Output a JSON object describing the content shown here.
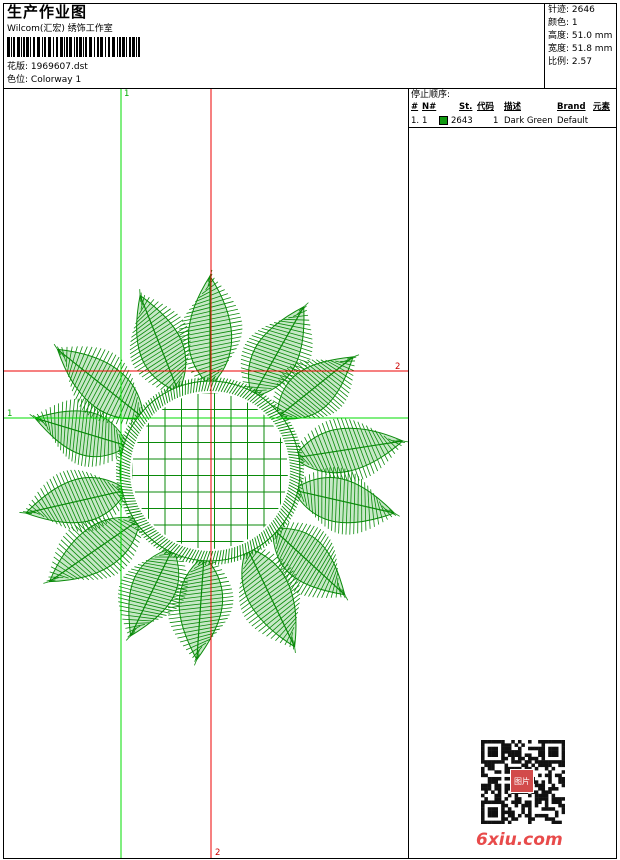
{
  "header": {
    "title": "生产作业图",
    "studio": "Wilcom(汇宏) 绣饰工作室",
    "design_label": "花版:",
    "design_file": "1969607.dst",
    "color_label": "色位:",
    "colorway": "Colorway 1"
  },
  "stats": [
    {
      "label": "针迹:",
      "value": "2646"
    },
    {
      "label": "颜色:",
      "value": "1"
    },
    {
      "label": "高度:",
      "value": "51.0 mm"
    },
    {
      "label": "宽度:",
      "value": "51.8 mm"
    },
    {
      "label": "比例:",
      "value": "2.57"
    }
  ],
  "stop_sequence": {
    "title": "停止顺序:",
    "headers": [
      "#",
      "N#",
      "St.",
      "代码",
      "描述",
      "Brand",
      "元素"
    ],
    "rows": [
      {
        "index": "1.",
        "needle": "1",
        "stitches": "2643",
        "code": "1",
        "description": "Dark Green",
        "brand": "Default",
        "color": "#119911"
      }
    ]
  },
  "design_view": {
    "thread_color": "#0a8a0a",
    "guide_green": "#00dd00",
    "guide_red": "#ee0000",
    "markers": {
      "green_top": "1",
      "green_left": "1",
      "red_right": "2",
      "red_bottom": "2"
    }
  },
  "watermark": {
    "site": "6xiu.com",
    "seal": "图片"
  }
}
